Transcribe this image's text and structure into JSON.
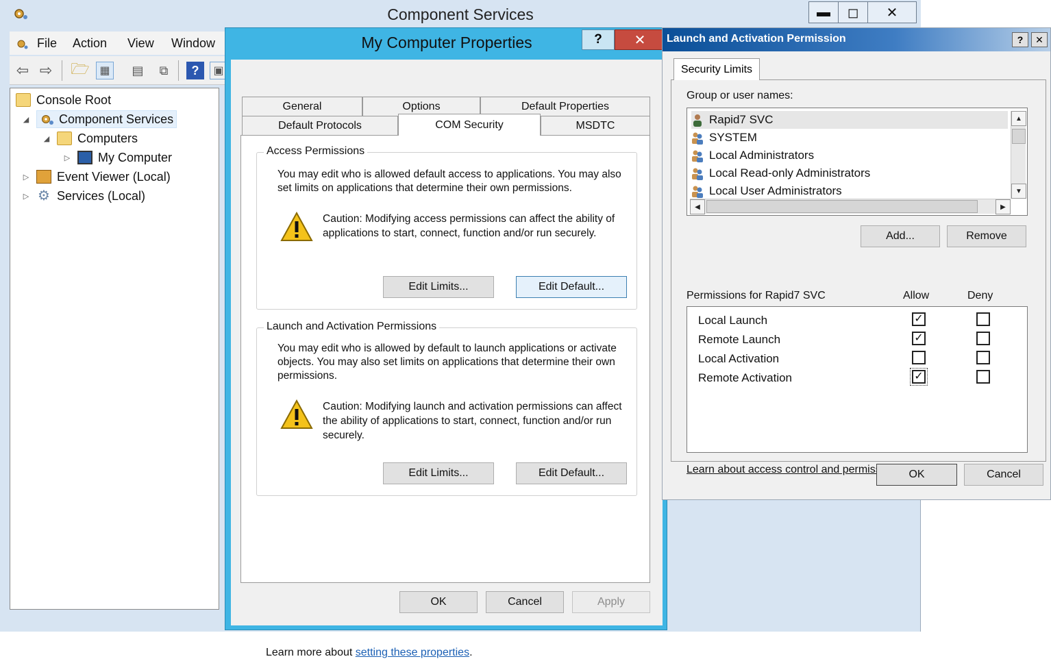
{
  "mmc": {
    "title": "Component Services",
    "caption_buttons": {
      "minimize": "▬",
      "maximize": "◻",
      "close": "✕"
    },
    "menu": [
      "File",
      "Action",
      "View",
      "Window"
    ],
    "tree": [
      {
        "label": "Console Root",
        "icon": "folder-icon"
      },
      {
        "label": "Component Services",
        "icon": "component-services-icon",
        "selected": true
      },
      {
        "label": "Computers",
        "icon": "folder-icon"
      },
      {
        "label": "My Computer",
        "icon": "computer-icon"
      },
      {
        "label": "Event Viewer (Local)",
        "icon": "event-viewer-icon"
      },
      {
        "label": "Services (Local)",
        "icon": "services-icon"
      }
    ]
  },
  "props": {
    "title": "My Computer Properties",
    "help": "?",
    "close": "✕",
    "tabs_top": [
      "General",
      "Options",
      "Default Properties"
    ],
    "tabs_bottom": [
      "Default Protocols",
      "COM Security",
      "MSDTC"
    ],
    "active_tab": "COM Security",
    "access": {
      "legend": "Access Permissions",
      "desc": "You may edit who is allowed default access to applications. You may also set limits on applications that determine their own permissions.",
      "caution": "Caution: Modifying access permissions can affect the ability of applications to start, connect, function and/or run securely.",
      "edit_limits": "Edit Limits...",
      "edit_default": "Edit Default..."
    },
    "launch": {
      "legend": "Launch and Activation Permissions",
      "desc": "You may edit who is allowed by default to launch applications or activate objects. You may also set limits on applications that determine their own permissions.",
      "caution": "Caution: Modifying launch and activation permissions can affect the ability of applications to start, connect, function and/or run securely.",
      "edit_limits": "Edit Limits...",
      "edit_default": "Edit Default..."
    },
    "learn_more_prefix": "Learn more about ",
    "learn_more_link": "setting these properties",
    "learn_more_suffix": ".",
    "ok": "OK",
    "cancel": "Cancel",
    "apply": "Apply"
  },
  "lap": {
    "title": "Launch and Activation Permission",
    "help": "?",
    "close": "✕",
    "tab": "Security Limits",
    "group_label": "Group or user names:",
    "users": [
      "Rapid7 SVC",
      "SYSTEM",
      "Local Administrators",
      "Local Read-only Administrators",
      "Local User Administrators"
    ],
    "selected_user": "Rapid7 SVC",
    "add": "Add...",
    "remove": "Remove",
    "perm_header": "Permissions for Rapid7 SVC",
    "allow_header": "Allow",
    "deny_header": "Deny",
    "permissions": [
      {
        "name": "Local Launch",
        "allow": true,
        "deny": false
      },
      {
        "name": "Remote Launch",
        "allow": true,
        "deny": false
      },
      {
        "name": "Local Activation",
        "allow": false,
        "deny": false
      },
      {
        "name": "Remote Activation",
        "allow": true,
        "deny": false
      }
    ],
    "learn_link": "Learn about access control and permissions",
    "ok": "OK",
    "cancel": "Cancel"
  }
}
